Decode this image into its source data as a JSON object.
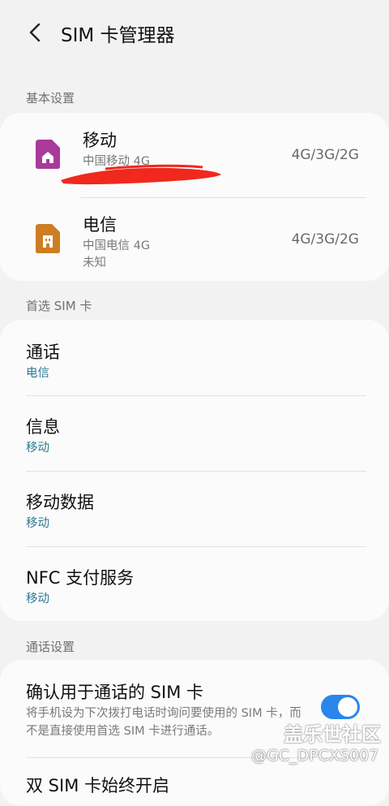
{
  "header": {
    "title": "SIM 卡管理器",
    "back_icon": "back-arrow-icon"
  },
  "sections": {
    "basic": "基本设置",
    "preferred": "首选 SIM 卡",
    "call_settings": "通话设置"
  },
  "sims": [
    {
      "name": "移动",
      "carrier": "中国移动 4G",
      "status": "",
      "network": "4G/3G/2G",
      "icon": "sim-card-icon",
      "color": "#a93a99"
    },
    {
      "name": "电信",
      "carrier": "中国电信 4G",
      "status": "未知",
      "network": "4G/3G/2G",
      "icon": "sim-card-icon",
      "color": "#cd7d24"
    }
  ],
  "preferred": [
    {
      "title": "通话",
      "value": "电信"
    },
    {
      "title": "信息",
      "value": "移动"
    },
    {
      "title": "移动数据",
      "value": "移动"
    },
    {
      "title": "NFC 支付服务",
      "value": "移动"
    }
  ],
  "call_settings": {
    "confirm_title": "确认用于通话的 SIM 卡",
    "confirm_desc": "将手机设为下次拨打电话时询问要使用的 SIM 卡，而不是直接使用首选 SIM 卡进行通话。",
    "confirm_enabled": true,
    "next_title_partial": "双 SIM 卡始终开启"
  },
  "watermark": {
    "main": "盖乐世社区",
    "sub": "@GC_DPCXS007"
  },
  "colors": {
    "accent": "#2a86ea",
    "value_text": "#2f7b93",
    "redaction": "#f0281e"
  }
}
